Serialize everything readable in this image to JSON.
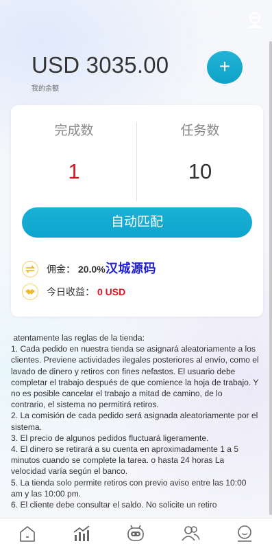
{
  "header": {
    "balance": "USD 3035.00",
    "balance_label": "我的余额",
    "add_label": "+"
  },
  "stats": {
    "completed_title": "完成数",
    "completed_value": "1",
    "tasks_title": "任务数",
    "tasks_value": "10"
  },
  "match_button": "自动匹配",
  "info": {
    "commission_label": "佣金：",
    "commission_value": "20.0%",
    "today_label": "今日收益：",
    "today_value": "0 USD"
  },
  "watermark": "汉城源码",
  "rules_text": " atentamente las reglas de la tienda:\n1. Cada pedido en nuestra tienda se asignará aleatoriamente a los clientes. Previene actividades ilegales posteriores al envío, como el lavado de dinero y retiros con fines nefastos. El usuario debe completar el trabajo después de que comience la hoja de trabajo. Y no es posible cancelar el trabajo a mitad de camino, de lo contrario, el sistema no permitirá retiros.\n2. La comisión de cada pedido será asignada aleatoriamente por el sistema.\n3. El precio de algunos pedidos fluctuará ligeramente.\n4. El dinero se retirará a su cuenta en aproximadamente 1 a 5 minutos cuando se complete la tarea. o hasta 24 horas La velocidad varía según el banco.\n5. La tienda solo permite retiros con previo aviso entre las 10:00 am y las 10:00 pm.\n6. El cliente debe consultar el saldo. No solicite un retiro",
  "colors": {
    "accent": "#12a8cf",
    "completed_value": "#e0141e",
    "today_value": "#e0141e",
    "watermark": "#1f1fd8"
  },
  "tabbar": {
    "icons": [
      "home-icon",
      "chart-icon",
      "robot-icon",
      "team-icon",
      "profile-icon"
    ]
  }
}
